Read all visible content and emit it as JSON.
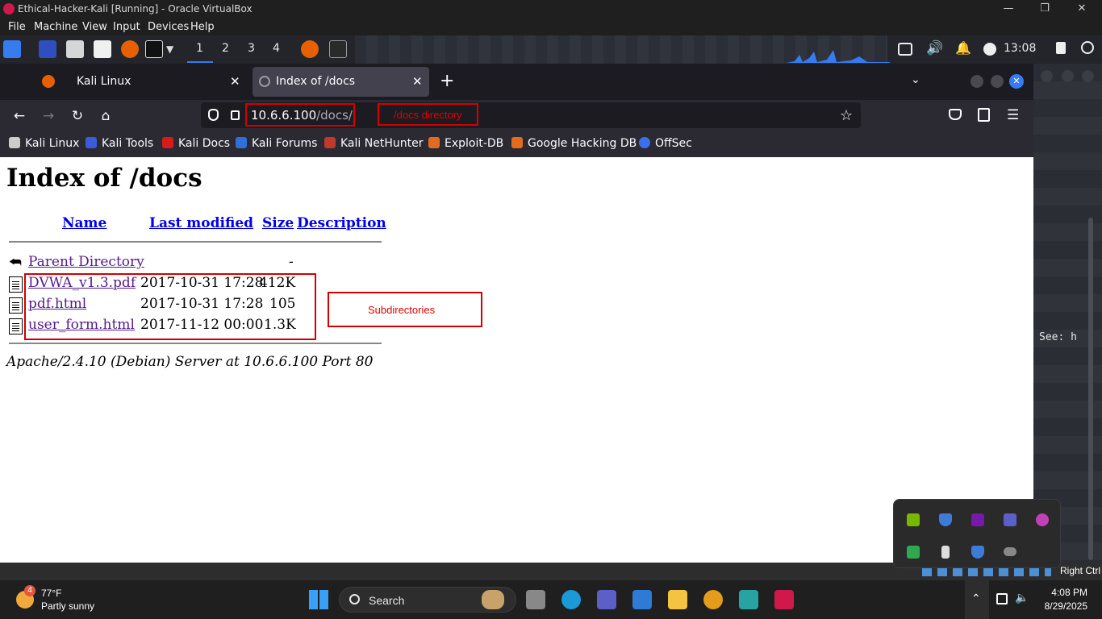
{
  "vbox": {
    "title": "Ethical-Hacker-Kali [Running] - Oracle VirtualBox",
    "menu": [
      "File",
      "Machine",
      "View",
      "Input",
      "Devices",
      "Help"
    ],
    "status_hostkey": "Right Ctrl"
  },
  "kali_panel": {
    "workspaces": [
      "1",
      "2",
      "3",
      "4"
    ],
    "clock": "13:08"
  },
  "firefox": {
    "tabs": [
      {
        "label": "Kali Linux"
      },
      {
        "label": "Index of /docs"
      }
    ],
    "url_host": "10.6.6.100",
    "url_path": "/docs/",
    "bookmarks": [
      "Kali Linux",
      "Kali Tools",
      "Kali Docs",
      "Kali Forums",
      "Kali NetHunter",
      "Exploit-DB",
      "Google Hacking DB",
      "OffSec"
    ]
  },
  "page": {
    "title": "Index of /docs",
    "columns": [
      "Name",
      "Last modified",
      "Size",
      "Description"
    ],
    "parent": {
      "name": "Parent Directory",
      "size": "-"
    },
    "files": [
      {
        "name": "DVWA_v1.3.pdf",
        "modified": "2017-10-31 17:28",
        "size": "412K"
      },
      {
        "name": "pdf.html",
        "modified": "2017-10-31 17:28",
        "size": "105"
      },
      {
        "name": "user_form.html",
        "modified": "2017-11-12 00:00",
        "size": "1.3K"
      }
    ],
    "address": "Apache/2.4.10 (Debian) Server at 10.6.6.100 Port 80"
  },
  "annotations": {
    "url_note": "/docs directory",
    "files_note": "Subdirectories"
  },
  "terminal_peek": "See: h",
  "windows_taskbar": {
    "weather_badge": "4",
    "temperature": "77°F",
    "weather": "Partly sunny",
    "search": "Search",
    "time": "4:08 PM",
    "date": "8/29/2025"
  },
  "colors": {
    "annotation_red": "#d40000",
    "link_visited": "#551a8b",
    "link": "#0000ee",
    "kali_blue": "#367bf0"
  }
}
